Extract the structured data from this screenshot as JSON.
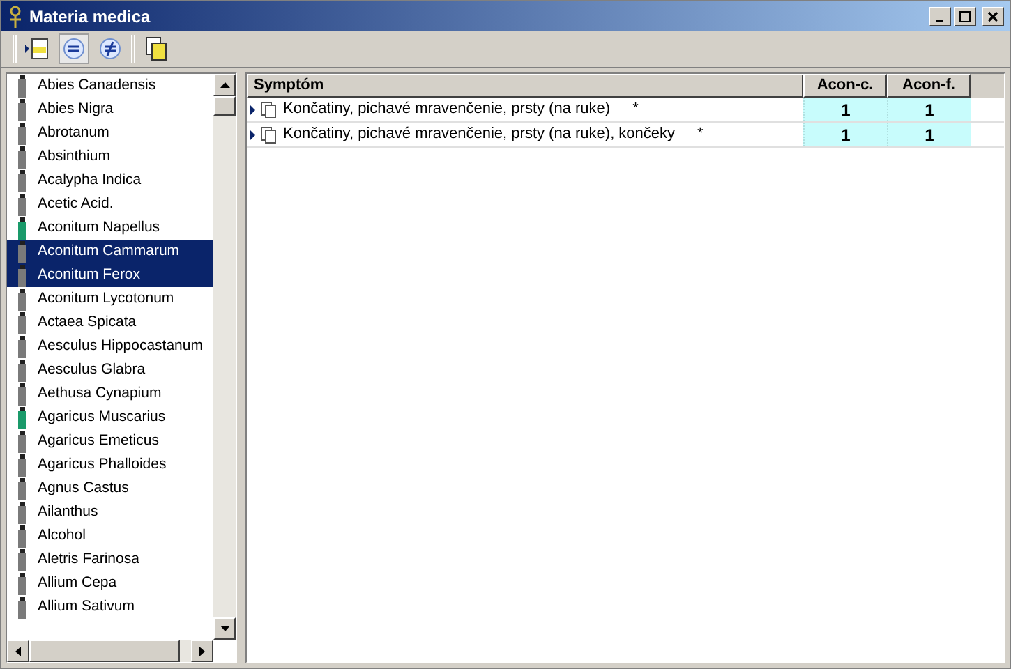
{
  "window": {
    "title": "Materia medica"
  },
  "remedies": [
    {
      "name": "Abies Canadensis",
      "color": "#7a7a7a",
      "selected": false
    },
    {
      "name": "Abies Nigra",
      "color": "#7a7a7a",
      "selected": false
    },
    {
      "name": "Abrotanum",
      "color": "#7a7a7a",
      "selected": false
    },
    {
      "name": "Absinthium",
      "color": "#7a7a7a",
      "selected": false
    },
    {
      "name": "Acalypha Indica",
      "color": "#7a7a7a",
      "selected": false
    },
    {
      "name": "Acetic Acid.",
      "color": "#7a7a7a",
      "selected": false
    },
    {
      "name": "Aconitum Napellus",
      "color": "#1a9a6a",
      "selected": false
    },
    {
      "name": "Aconitum Cammarum",
      "color": "#7a7a7a",
      "selected": true
    },
    {
      "name": "Aconitum Ferox",
      "color": "#7a7a7a",
      "selected": true
    },
    {
      "name": "Aconitum Lycotonum",
      "color": "#7a7a7a",
      "selected": false
    },
    {
      "name": "Actaea Spicata",
      "color": "#7a7a7a",
      "selected": false
    },
    {
      "name": "Aesculus Hippocastanum",
      "color": "#7a7a7a",
      "selected": false
    },
    {
      "name": "Aesculus Glabra",
      "color": "#7a7a7a",
      "selected": false
    },
    {
      "name": "Aethusa Cynapium",
      "color": "#7a7a7a",
      "selected": false
    },
    {
      "name": "Agaricus Muscarius",
      "color": "#1a9a6a",
      "selected": false
    },
    {
      "name": "Agaricus Emeticus",
      "color": "#7a7a7a",
      "selected": false
    },
    {
      "name": "Agaricus Phalloides",
      "color": "#7a7a7a",
      "selected": false
    },
    {
      "name": "Agnus Castus",
      "color": "#7a7a7a",
      "selected": false
    },
    {
      "name": "Ailanthus",
      "color": "#7a7a7a",
      "selected": false
    },
    {
      "name": "Alcohol",
      "color": "#7a7a7a",
      "selected": false
    },
    {
      "name": "Aletris Farinosa",
      "color": "#7a7a7a",
      "selected": false
    },
    {
      "name": "Allium Cepa",
      "color": "#7a7a7a",
      "selected": false
    },
    {
      "name": "Allium Sativum",
      "color": "#7a7a7a",
      "selected": false
    }
  ],
  "table": {
    "columns": [
      "Symptóm",
      "Acon-c.",
      "Acon-f."
    ],
    "rows": [
      {
        "symptom": "Končatiny, pichavé mravenčenie, prsty (na ruke)",
        "mark": "*",
        "values": [
          "1",
          "1"
        ]
      },
      {
        "symptom": "Končatiny, pichavé mravenčenie, prsty (na ruke), končeky",
        "mark": "*",
        "values": [
          "1",
          "1"
        ]
      }
    ]
  }
}
